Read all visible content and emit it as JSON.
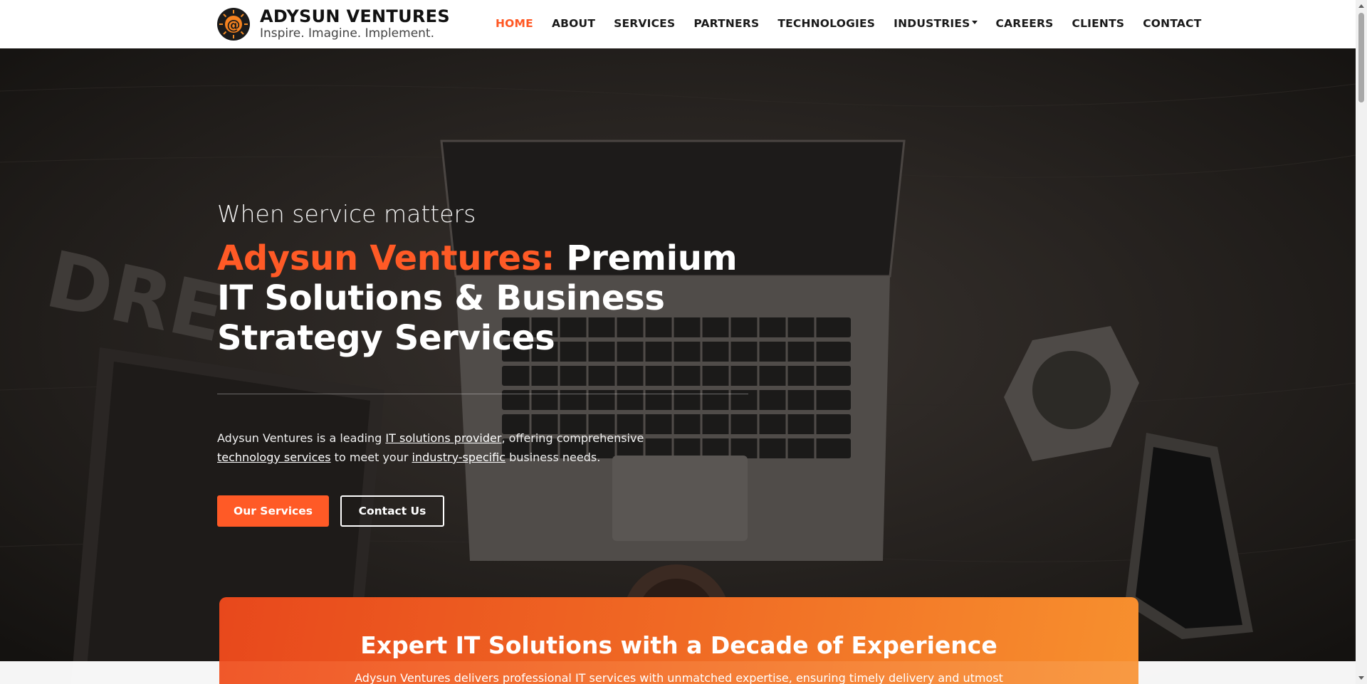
{
  "brand": {
    "name": "ADYSUN VENTURES",
    "tagline": "Inspire. Imagine. Implement.",
    "logo_icon": "at-sign-sun-logo"
  },
  "nav": {
    "items": [
      {
        "label": "HOME",
        "active": true
      },
      {
        "label": "ABOUT"
      },
      {
        "label": "SERVICES"
      },
      {
        "label": "PARTNERS"
      },
      {
        "label": "TECHNOLOGIES"
      },
      {
        "label": "INDUSTRIES",
        "dropdown": true
      },
      {
        "label": "CAREERS"
      },
      {
        "label": "CLIENTS"
      },
      {
        "label": "CONTACT"
      }
    ]
  },
  "hero": {
    "kicker": "When service matters",
    "title_accent": "Adysun Ventures:",
    "title_rest": " Premium IT Solutions & Business Strategy Services",
    "desc_1": "Adysun Ventures is a leading ",
    "desc_link_1": "IT solutions provider",
    "desc_2": ", offering comprehensive ",
    "desc_link_2": "technology services",
    "desc_3": " to meet your ",
    "desc_link_3": "industry-specific",
    "desc_4": " business needs.",
    "primary_button": "Our Services",
    "secondary_button": "Contact Us"
  },
  "card": {
    "title": "Expert IT Solutions with a Decade of Experience",
    "subtitle": "Adysun Ventures delivers professional IT services with unmatched expertise, ensuring timely delivery and utmost"
  },
  "colors": {
    "accent": "#ff5a26",
    "hero_bg": "#262220",
    "card_start": "#e8481c",
    "card_end": "#f7902e"
  }
}
